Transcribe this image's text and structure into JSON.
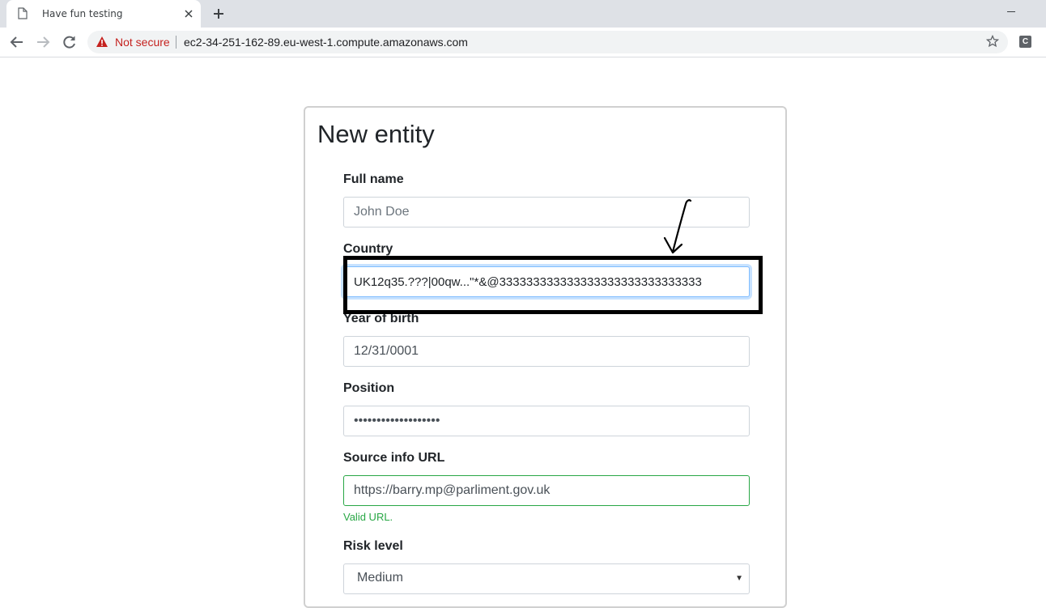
{
  "browser": {
    "tab_title": "Have fun testing",
    "security_label": "Not secure",
    "url": "ec2-34-251-162-89.eu-west-1.compute.amazonaws.com",
    "extension_letter": "C"
  },
  "form": {
    "title": "New entity",
    "full_name": {
      "label": "Full name",
      "placeholder": "John Doe",
      "value": ""
    },
    "country": {
      "label": "Country",
      "value": "UK12q35.???|00qw...\"*&@333333333333333333333333333333"
    },
    "year_of_birth": {
      "label": "Year of birth",
      "value": "12/31/0001"
    },
    "position": {
      "label": "Position",
      "value": "•••••••••••••••••••"
    },
    "source_url": {
      "label": "Source info URL",
      "value": "https://barry.mp@parliment.gov.uk",
      "feedback": "Valid URL."
    },
    "risk_level": {
      "label": "Risk level",
      "selected": "Medium"
    }
  },
  "colors": {
    "valid": "#28a745",
    "focus": "#80bdff",
    "not_secure": "#c5221f",
    "annotation": "#000000"
  }
}
